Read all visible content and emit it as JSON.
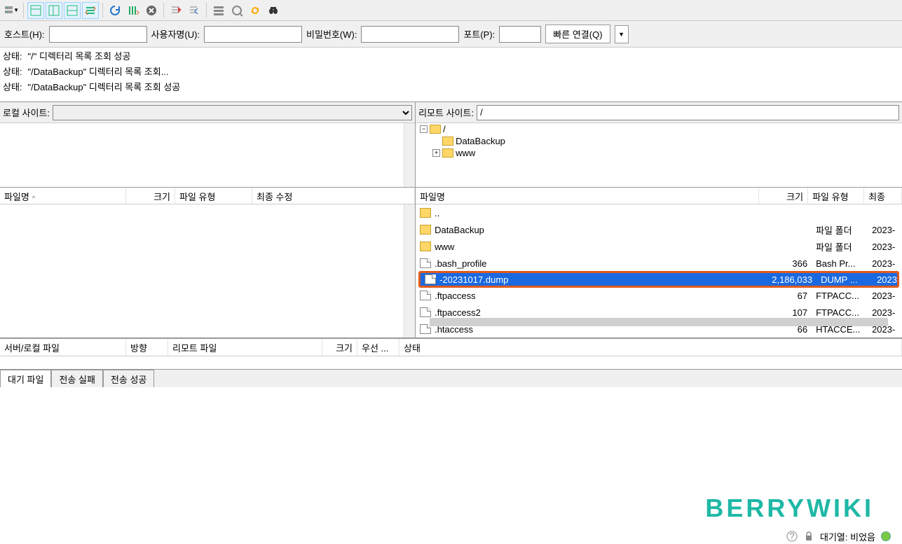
{
  "toolbar": {
    "site_manager": "site-manager"
  },
  "quickconnect": {
    "host_label": "호스트(H):",
    "user_label": "사용자명(U):",
    "pass_label": "비밀번호(W):",
    "port_label": "포트(P):",
    "connect_btn": "빠른 연결(Q)"
  },
  "log": [
    {
      "prefix": "상태:",
      "msg": "\"/\" 디렉터리 목록 조회 성공"
    },
    {
      "prefix": "상태:",
      "msg": "\"/DataBackup\" 디렉터리 목록 조회..."
    },
    {
      "prefix": "상태:",
      "msg": "\"/DataBackup\" 디렉터리 목록 조회 성공"
    }
  ],
  "local": {
    "label": "로컬 사이트:",
    "cols": {
      "name": "파일명",
      "size": "크기",
      "type": "파일 유형",
      "mtime": "최종 수정"
    }
  },
  "remote": {
    "label": "리모트 사이트:",
    "path": "/",
    "tree": {
      "root": "/",
      "children": [
        "DataBackup",
        "www"
      ]
    },
    "cols": {
      "name": "파일명",
      "size": "크기",
      "type": "파일 유형",
      "mtime": "최종"
    },
    "files": [
      {
        "name": "..",
        "size": "",
        "type": "",
        "mtime": "",
        "icon": "folder"
      },
      {
        "name": "DataBackup",
        "size": "",
        "type": "파일 폴더",
        "mtime": "2023-",
        "icon": "folder"
      },
      {
        "name": "www",
        "size": "",
        "type": "파일 폴더",
        "mtime": "2023-",
        "icon": "folder"
      },
      {
        "name": ".bash_profile",
        "size": "366",
        "type": "Bash Pr...",
        "mtime": "2023-",
        "icon": "file"
      },
      {
        "name": "        -20231017.dump",
        "size": "2,186,033",
        "type": "DUMP ...",
        "mtime": "2023",
        "icon": "file",
        "selected": true,
        "highlighted": true
      },
      {
        "name": ".ftpaccess",
        "size": "67",
        "type": "FTPACC...",
        "mtime": "2023-",
        "icon": "file"
      },
      {
        "name": ".ftpaccess2",
        "size": "107",
        "type": "FTPACC...",
        "mtime": "2023-",
        "icon": "file"
      },
      {
        "name": ".htaccess",
        "size": "66",
        "type": "HTACCE...",
        "mtime": "2023-",
        "icon": "file"
      }
    ]
  },
  "queue": {
    "cols": {
      "srv": "서버/로컬 파일",
      "dir": "방향",
      "remote": "리모트 파일",
      "size": "크기",
      "prio": "우선 ...",
      "status": "상태"
    }
  },
  "tabs": {
    "queue": "대기 파일",
    "failed": "전송 실패",
    "success": "전송 성공"
  },
  "status": {
    "queue_label": "대기열: 비었음"
  },
  "watermark": "BERRYWIKI"
}
